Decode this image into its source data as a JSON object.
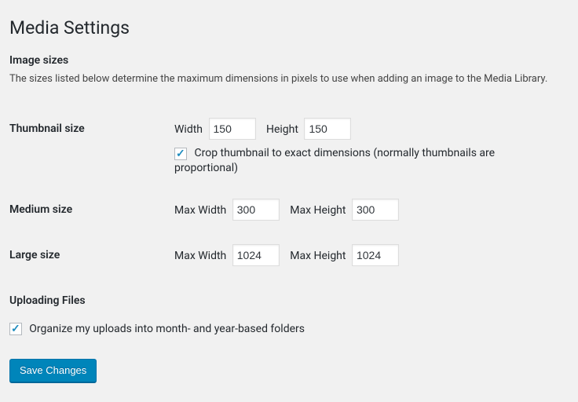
{
  "page_title": "Media Settings",
  "image_sizes": {
    "heading": "Image sizes",
    "description": "The sizes listed below determine the maximum dimensions in pixels to use when adding an image to the Media Library.",
    "thumbnail": {
      "label": "Thumbnail size",
      "width_label": "Width",
      "width_value": "150",
      "height_label": "Height",
      "height_value": "150",
      "crop_checked": true,
      "crop_label": "Crop thumbnail to exact dimensions (normally thumbnails are proportional)"
    },
    "medium": {
      "label": "Medium size",
      "max_width_label": "Max Width",
      "max_width_value": "300",
      "max_height_label": "Max Height",
      "max_height_value": "300"
    },
    "large": {
      "label": "Large size",
      "max_width_label": "Max Width",
      "max_width_value": "1024",
      "max_height_label": "Max Height",
      "max_height_value": "1024"
    }
  },
  "uploading": {
    "heading": "Uploading Files",
    "organize_checked": true,
    "organize_label": "Organize my uploads into month- and year-based folders"
  },
  "save_button": "Save Changes"
}
